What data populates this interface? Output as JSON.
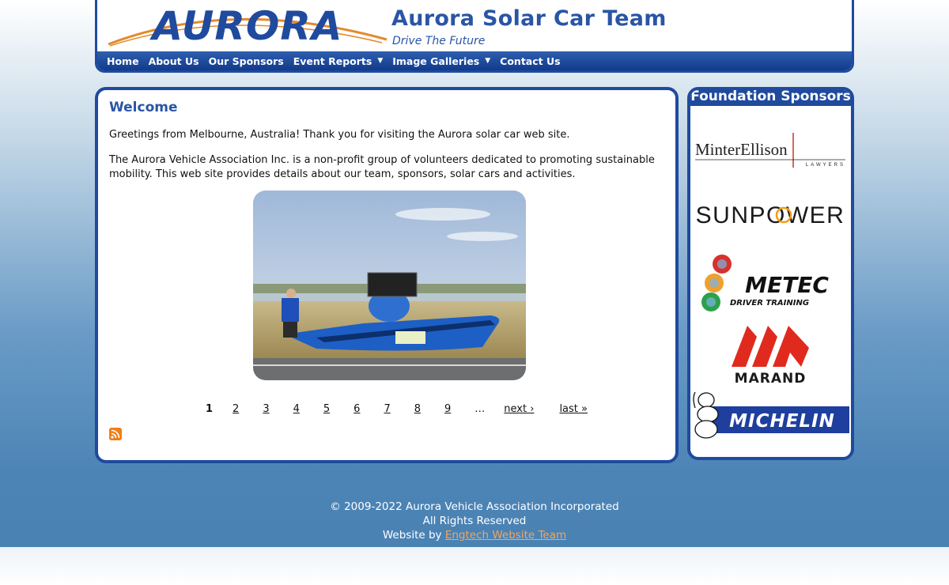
{
  "header": {
    "logo_text": "AURORA",
    "title": "Aurora Solar Car Team",
    "slogan": "Drive The Future"
  },
  "nav": [
    {
      "label": "Home",
      "dropdown": false
    },
    {
      "label": "About Us",
      "dropdown": false
    },
    {
      "label": "Our Sponsors",
      "dropdown": false
    },
    {
      "label": "Event Reports",
      "dropdown": true
    },
    {
      "label": "Image Galleries",
      "dropdown": true
    },
    {
      "label": "Contact Us",
      "dropdown": false
    }
  ],
  "main": {
    "heading": "Welcome",
    "paragraph1": "Greetings from Melbourne, Australia!  Thank you for visiting the Aurora solar car web site.",
    "paragraph2": "The Aurora Vehicle Association Inc. is a non-profit group of volunteers dedicated to promoting sustainable mobility.  This web site provides details about our team, sponsors, solar cars and activities.",
    "pager": {
      "current": "1",
      "pages": [
        "2",
        "3",
        "4",
        "5",
        "6",
        "7",
        "8",
        "9"
      ],
      "ellipsis": "…",
      "next": "next ›",
      "last": "last »"
    }
  },
  "sidebar": {
    "title": "Foundation Sponsors",
    "sponsors": [
      {
        "name": "MinterEllison",
        "sub": "LAWYERS"
      },
      {
        "name": "SUNPOWER"
      },
      {
        "name": "METEC",
        "sub": "DRIVER TRAINING"
      },
      {
        "name": "MARAND"
      },
      {
        "name": "MICHELIN"
      }
    ]
  },
  "footer": {
    "copyright": "© 2009-2022 Aurora Vehicle Association Incorporated",
    "rights": "All Rights Reserved",
    "website_by": "Website by",
    "website_link": "Engtech Website Team"
  },
  "colors": {
    "brand_blue": "#1f4a9e",
    "title_blue": "#2a55a5",
    "link_orange": "#f2a75a"
  }
}
